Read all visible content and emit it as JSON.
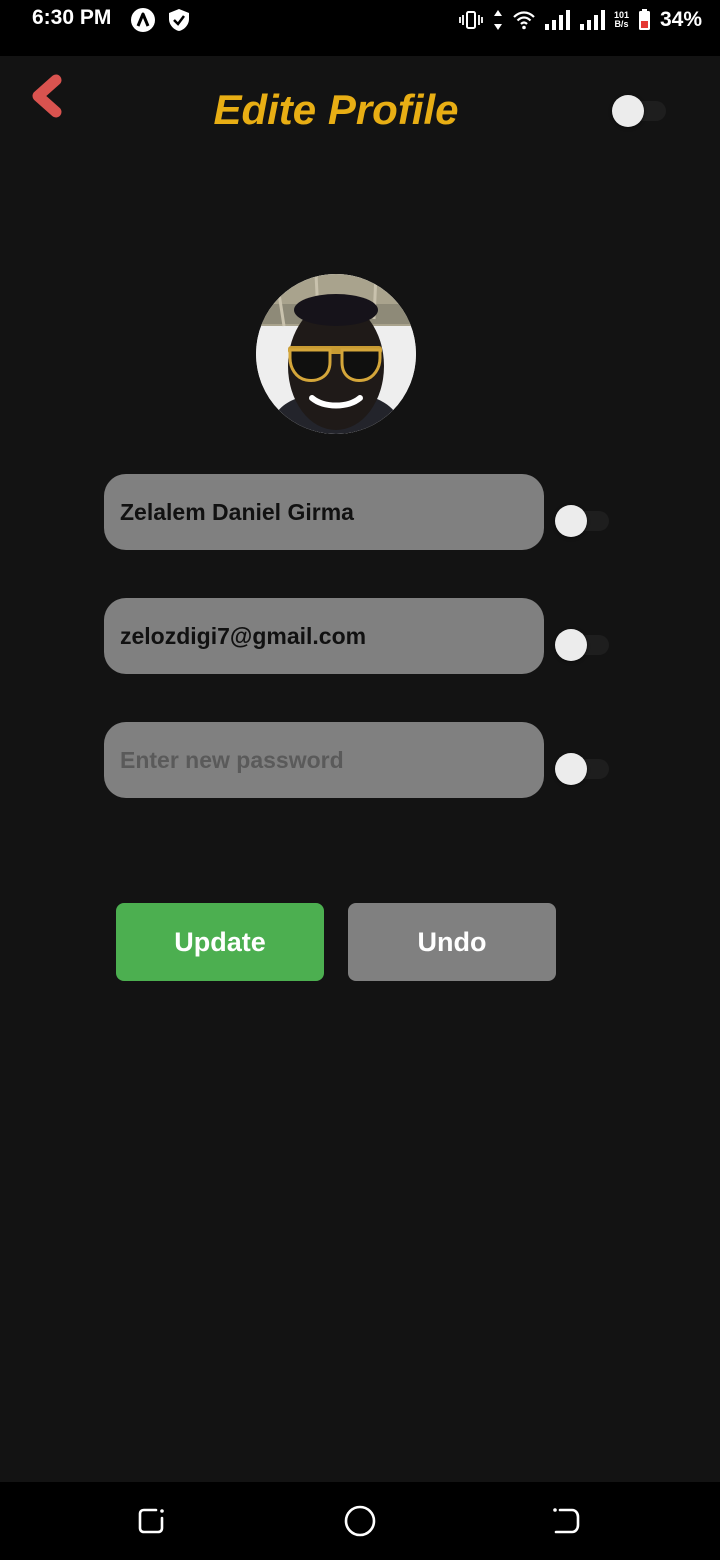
{
  "status_bar": {
    "time": "6:30 PM",
    "speed_value": "101",
    "speed_unit": "B/s",
    "battery": "34%",
    "icons": [
      "app-a-icon",
      "shield-icon",
      "vibrate-icon",
      "data-arrows-icon",
      "wifi-icon",
      "signal-icon",
      "signal-icon",
      "battery-icon"
    ]
  },
  "header": {
    "title": "Edite Profile",
    "back_icon": "chevron-left-icon",
    "theme_switch": "off"
  },
  "form": {
    "name_value": "Zelalem Daniel Girma",
    "email_value": "zelozdigi7@gmail.com",
    "password_value": "",
    "password_placeholder": "Enter new password",
    "name_switch": "off",
    "email_switch": "off",
    "password_switch": "off"
  },
  "actions": {
    "update_label": "Update",
    "undo_label": "Undo"
  },
  "colors": {
    "title": "#e8ae14",
    "update": "#4caf50",
    "undo": "#808080",
    "back": "#d9534f",
    "background": "#131313",
    "field": "#808080"
  },
  "nav_bar": {
    "icons": [
      "recents-icon",
      "home-icon",
      "back-nav-icon"
    ]
  }
}
